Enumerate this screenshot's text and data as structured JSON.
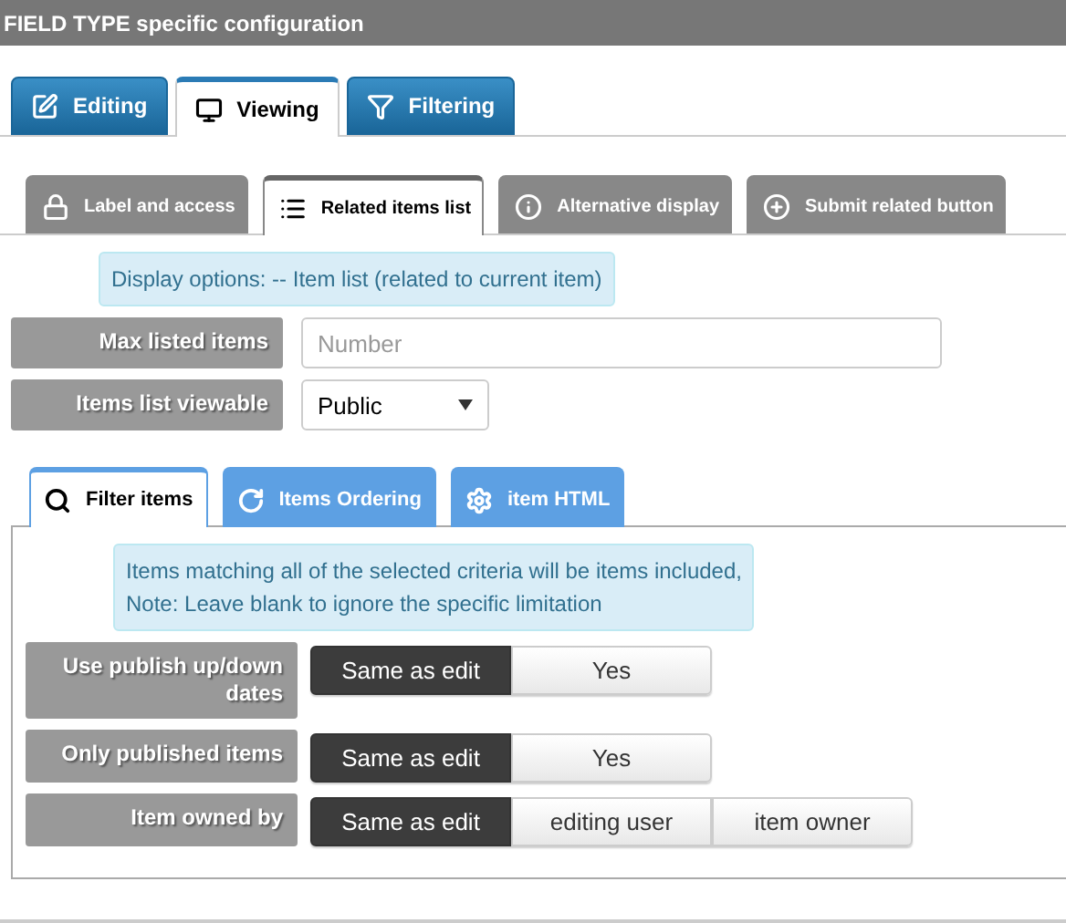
{
  "header": {
    "title": "FIELD TYPE specific configuration"
  },
  "tabs": [
    {
      "label": "Editing",
      "selected": false
    },
    {
      "label": "Viewing",
      "selected": true
    },
    {
      "label": "Filtering",
      "selected": false
    }
  ],
  "sub_tabs": [
    {
      "label": "Label and access",
      "selected": false
    },
    {
      "label": "Related items list",
      "selected": true
    },
    {
      "label": "Alternative display",
      "selected": false
    },
    {
      "label": "Submit related button",
      "selected": false
    }
  ],
  "display_info": "Display options: -- Item list (related to current item)",
  "fields": [
    {
      "label": "Max listed items",
      "kind": "text",
      "placeholder": "Number"
    },
    {
      "label": "Items list viewable",
      "kind": "select",
      "value": "Public"
    }
  ],
  "filter_tabs": [
    {
      "label": "Filter items",
      "selected": true
    },
    {
      "label": "Items Ordering",
      "selected": false
    },
    {
      "label": "item HTML",
      "selected": false
    }
  ],
  "filter_info": [
    "Items matching all of the selected criteria will be items included,",
    "Note: Leave blank to ignore the specific limitation"
  ],
  "options": [
    {
      "label": "Use publish up/down dates",
      "choices": [
        {
          "label": "Same as edit",
          "selected": true
        },
        {
          "label": "Yes",
          "selected": false
        }
      ]
    },
    {
      "label": "Only published items",
      "choices": [
        {
          "label": "Same as edit",
          "selected": true
        },
        {
          "label": "Yes",
          "selected": false
        }
      ]
    },
    {
      "label": "Item owned by",
      "choices": [
        {
          "label": "Same as edit",
          "selected": true
        },
        {
          "label": "editing user",
          "selected": false
        },
        {
          "label": "item owner",
          "selected": false
        }
      ]
    }
  ]
}
